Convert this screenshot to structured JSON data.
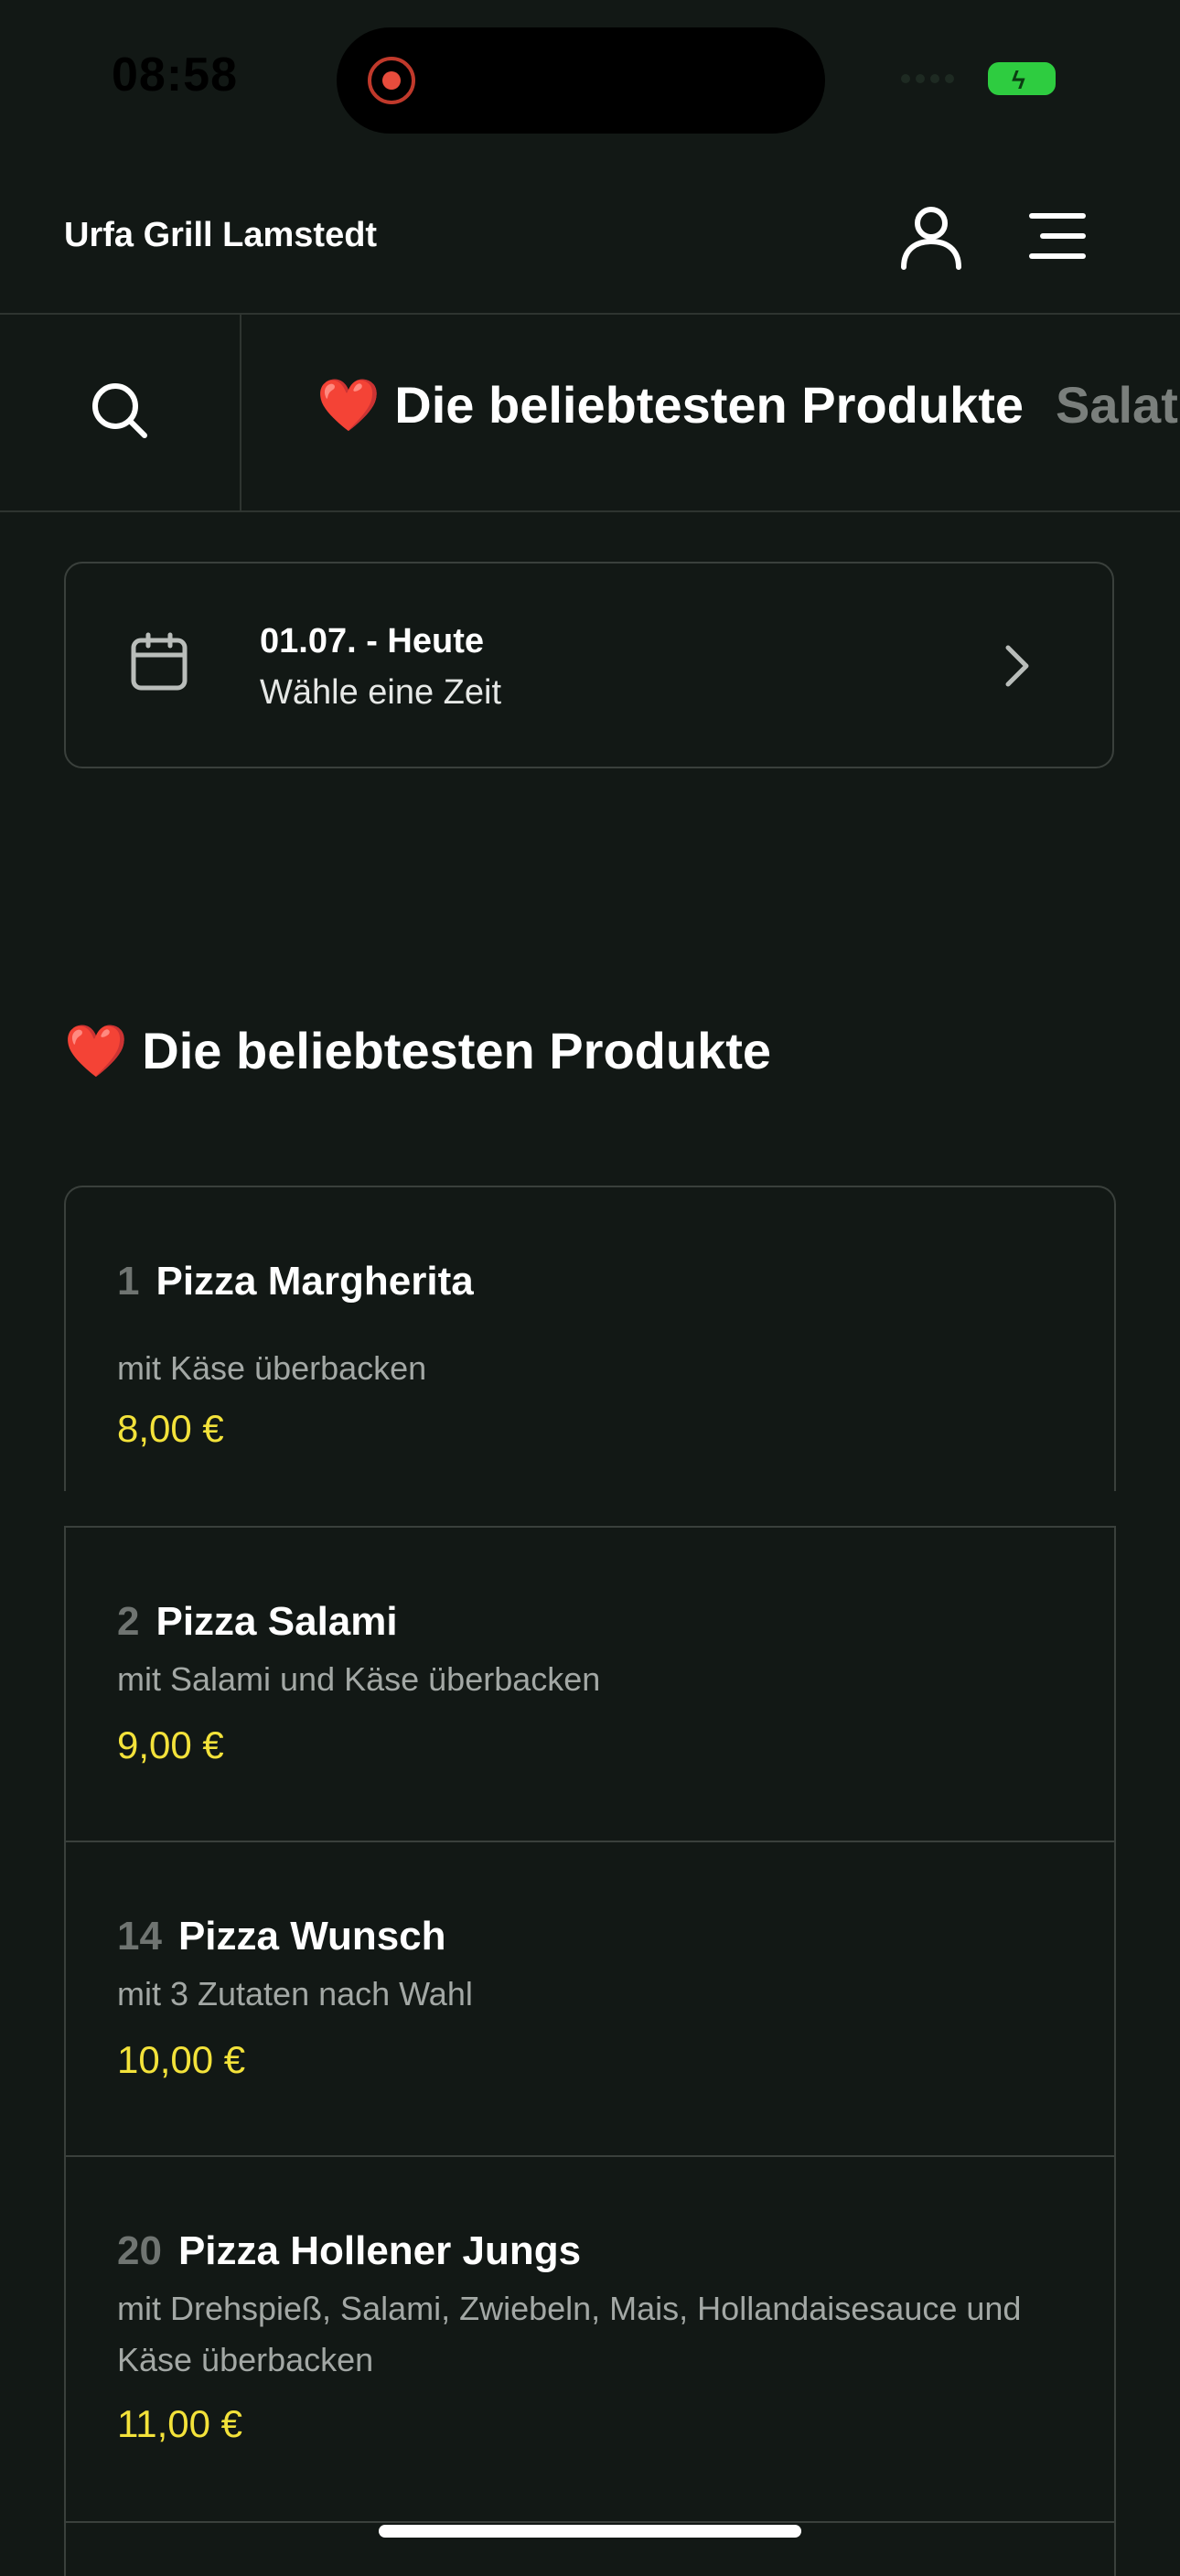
{
  "status_bar": {
    "time": "08:58"
  },
  "header": {
    "brand": "Urfa Grill Lamstedt",
    "user_icon": "user-icon",
    "menu_icon": "menu-icon"
  },
  "categories": [
    {
      "label": "❤️ Die beliebtesten Produkte",
      "active": true
    },
    {
      "label": "Salate",
      "active": false
    }
  ],
  "date_picker": {
    "title": "01.07. - Heute",
    "subtitle": "Wähle eine Zeit"
  },
  "section": {
    "title": "❤️ Die beliebtesten Produkte"
  },
  "products": [
    {
      "number": "1",
      "name": "Pizza Margherita",
      "description": "mit Käse überbacken",
      "price": "8,00 €"
    },
    {
      "number": "2",
      "name": "Pizza Salami",
      "description": "mit Salami und Käse überbacken",
      "price": "9,00 €"
    },
    {
      "number": "14",
      "name": "Pizza Wunsch",
      "description": "mit 3 Zutaten nach Wahl",
      "price": "10,00 €"
    },
    {
      "number": "20",
      "name": "Pizza Hollener Jungs",
      "description": "mit Drehspieß, Salami, Zwiebeln, Mais, Hollandaisesauce und Käse überbacken",
      "price": "11,00 €"
    }
  ],
  "colors": {
    "background": "#121815",
    "price": "#f3e23a",
    "border": "#3a403c",
    "muted": "#7a7f7c"
  }
}
